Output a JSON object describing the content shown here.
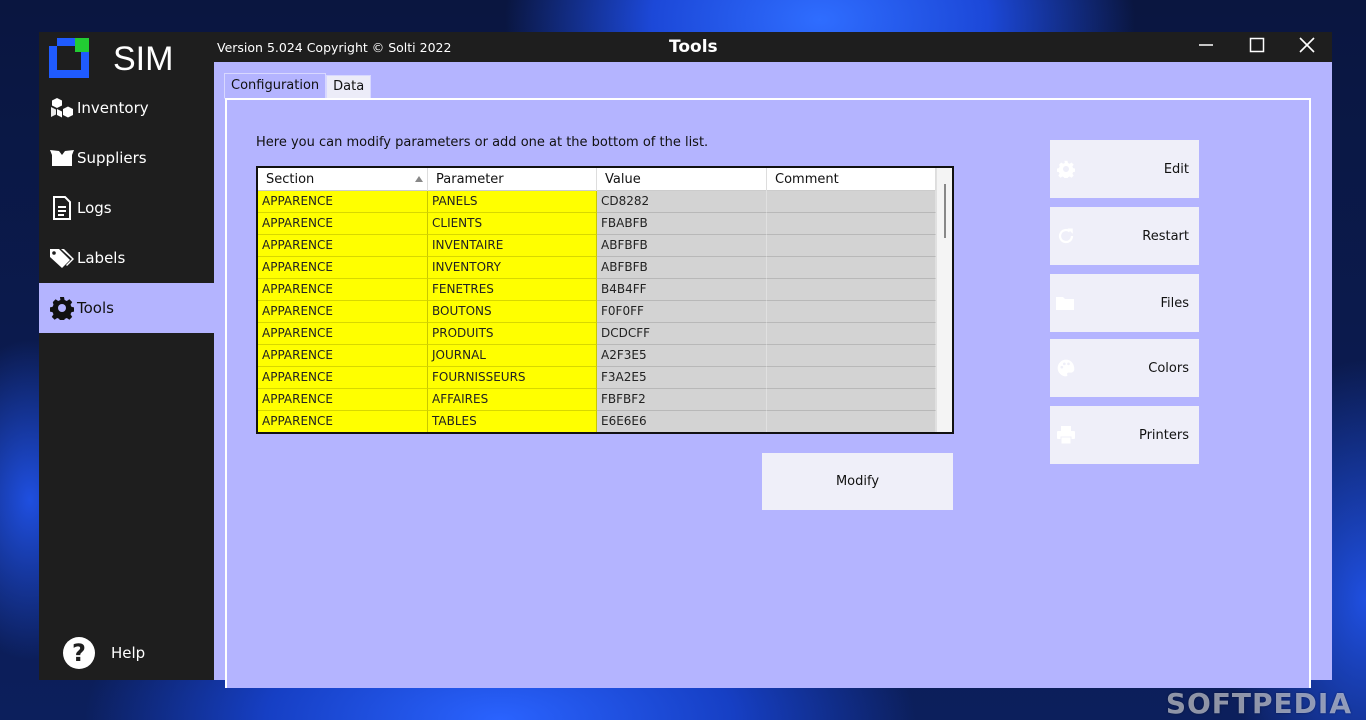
{
  "app": {
    "brand": "SIM",
    "version_text": "Version 5.024  Copyright © Solti 2022",
    "title": "Tools"
  },
  "sidebar": {
    "items": [
      {
        "label": "Inventory",
        "icon": "boxes-icon"
      },
      {
        "label": "Suppliers",
        "icon": "open-box-icon"
      },
      {
        "label": "Logs",
        "icon": "document-icon"
      },
      {
        "label": "Labels",
        "icon": "tags-icon"
      },
      {
        "label": "Tools",
        "icon": "gear-icon",
        "active": true
      }
    ],
    "help_label": "Help"
  },
  "tabs": [
    {
      "label": "Configuration",
      "active": true
    },
    {
      "label": "Data",
      "active": false
    }
  ],
  "configuration": {
    "intro": "Here you can modify parameters or add one at the bottom of the list.",
    "table": {
      "headers": [
        "Section",
        "Parameter",
        "Value",
        "Comment"
      ],
      "sorted_by": "Section",
      "rows": [
        [
          "APPARENCE",
          "PANELS",
          "CD8282",
          ""
        ],
        [
          "APPARENCE",
          "CLIENTS",
          "FBABFB",
          ""
        ],
        [
          "APPARENCE",
          "INVENTAIRE",
          "ABFBFB",
          ""
        ],
        [
          "APPARENCE",
          "INVENTORY",
          "ABFBFB",
          ""
        ],
        [
          "APPARENCE",
          "FENETRES",
          "B4B4FF",
          ""
        ],
        [
          "APPARENCE",
          "BOUTONS",
          "F0F0FF",
          ""
        ],
        [
          "APPARENCE",
          "PRODUITS",
          "DCDCFF",
          ""
        ],
        [
          "APPARENCE",
          "JOURNAL",
          "A2F3E5",
          ""
        ],
        [
          "APPARENCE",
          "FOURNISSEURS",
          "F3A2E5",
          ""
        ],
        [
          "APPARENCE",
          "AFFAIRES",
          "FBFBF2",
          ""
        ],
        [
          "APPARENCE",
          "TABLES",
          "E6E6E6",
          ""
        ]
      ]
    },
    "modify_label": "Modify"
  },
  "actions": [
    {
      "label": "Edit",
      "icon": "gear-icon"
    },
    {
      "label": "Restart",
      "icon": "refresh-icon"
    },
    {
      "label": "Files",
      "icon": "folder-icon"
    },
    {
      "label": "Colors",
      "icon": "palette-icon"
    },
    {
      "label": "Printers",
      "icon": "printer-icon"
    }
  ],
  "watermark": "SOFTPEDIA",
  "colors": {
    "sidebar_bg": "#1e1e1e",
    "content_bg": "#b4b4ff",
    "highlight_yellow": "#ffff00",
    "cell_gray": "#d3d3d3",
    "button_bg": "#efeff9",
    "logo_blue": "#1f5bff",
    "logo_green": "#22cc33"
  }
}
